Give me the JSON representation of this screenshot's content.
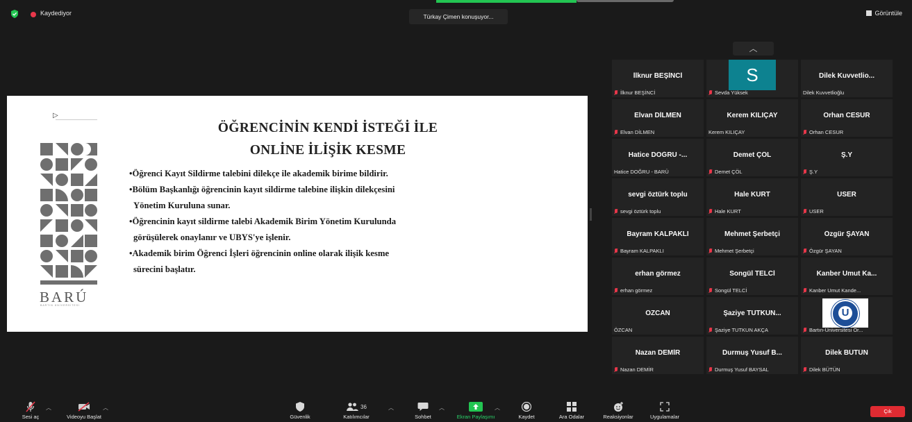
{
  "top": {
    "recording_label": "Kaydediyor",
    "speaker_label": "Türkay Çimen konuşuyor...",
    "view_label": "Görüntüle"
  },
  "slide": {
    "title_line1": "ÖĞRENCİNİN KENDİ İSTEĞİ İLE",
    "title_line2": "ONLİNE İLİŞİK KESME",
    "logo": "BARÚ",
    "logo_sub": "BARTIN ÜNİVERSİTESİ",
    "bullets": [
      {
        "l1": "Öğrenci Kayıt Sildirme talebini dilekçe ile akademik birime bildirir.",
        "l2": ""
      },
      {
        "l1": "Bölüm Başkanlığı öğrencinin kayıt sildirme talebine ilişkin dilekçesini",
        "l2": "Yönetim Kuruluna sunar."
      },
      {
        "l1": "Öğrencinin kayıt sildirme talebi Akademik Birim Yönetim Kurulunda",
        "l2": "görüşülerek onaylanır ve UBYS'ye işlenir."
      },
      {
        "l1": "Akademik birim Öğrenci İşleri öğrencinin online olarak ilişik kesme",
        "l2": "sürecini başlatır."
      }
    ]
  },
  "gallery": {
    "scroll_up_label": "︿",
    "avatar_letter": "S",
    "tiles": [
      {
        "name": "İlknur BEŞİNCİ",
        "caption": "İlknur BEŞİNCİ",
        "muted": true
      },
      {
        "name": "",
        "caption": "Sevda Yüksek",
        "muted": true
      },
      {
        "name": "Dilek Kuvvetlio...",
        "caption": "Dilek Kuvvetlioğlu",
        "muted": false
      },
      {
        "name": "Elvan DİLMEN",
        "caption": "Elvan DİLMEN",
        "muted": true
      },
      {
        "name": "Kerem KILIÇAY",
        "caption": "Kerem KILIÇAY",
        "muted": false
      },
      {
        "name": "Orhan CESUR",
        "caption": "Orhan CESUR",
        "muted": true
      },
      {
        "name": "Hatice DOĞRU -...",
        "caption": "Hatice DOĞRU - BARÜ",
        "muted": false
      },
      {
        "name": "Demet ÇÖL",
        "caption": "Demet ÇÖL",
        "muted": true
      },
      {
        "name": "Ş.Y",
        "caption": "Ş.Y",
        "muted": true
      },
      {
        "name": "sevgi öztürk toplu",
        "caption": "sevgi öztürk toplu",
        "muted": true
      },
      {
        "name": "Hale KURT",
        "caption": "Hale KURT",
        "muted": true
      },
      {
        "name": "USER",
        "caption": "USER",
        "muted": true
      },
      {
        "name": "Bayram KALPAKLI",
        "caption": "Bayram KALPAKLI",
        "muted": true
      },
      {
        "name": "Mehmet Şerbetçi",
        "caption": "Mehmet Şerbetçi",
        "muted": true
      },
      {
        "name": "Özgür ŞAYAN",
        "caption": "Özgür ŞAYAN",
        "muted": true
      },
      {
        "name": "erhan görmez",
        "caption": "erhan görmez",
        "muted": true
      },
      {
        "name": "Songül TELCİ",
        "caption": "Songül TELCİ",
        "muted": true
      },
      {
        "name": "Kanber Umut Ka...",
        "caption": "Kanber Umut Kande...",
        "muted": true
      },
      {
        "name": "ÖZCAN",
        "caption": "ÖZCAN",
        "muted": false
      },
      {
        "name": "Şaziye TUTKUN...",
        "caption": "Şaziye TUTKUN AKÇA",
        "muted": true
      },
      {
        "name": "",
        "caption": "Bartın-Üniversitesi Or...",
        "muted": true
      },
      {
        "name": "Nazan DEMİR",
        "caption": "Nazan DEMİR",
        "muted": true
      },
      {
        "name": "Durmuş Yusuf B...",
        "caption": "Durmuş Yusuf BAYSAL",
        "muted": true
      },
      {
        "name": "Dilek BÜTÜN",
        "caption": "Dilek BÜTÜN",
        "muted": true
      }
    ]
  },
  "toolbar": {
    "mute": "Sesi aç",
    "video": "Videoyu Başlat",
    "security": "Güvenlik",
    "participants": "Katılımcılar",
    "participants_count": "36",
    "chat": "Sohbet",
    "share": "Ekran Paylaşımı",
    "record": "Kaydet",
    "rooms": "Ara Odalar",
    "reactions": "Reaksiyonlar",
    "apps": "Uygulamalar",
    "leave": "Çık"
  },
  "colors": {
    "accent_green": "#23c552",
    "leave_red": "#e02b32",
    "muted_red": "#e8374a",
    "avatar_teal": "#0d8290"
  }
}
